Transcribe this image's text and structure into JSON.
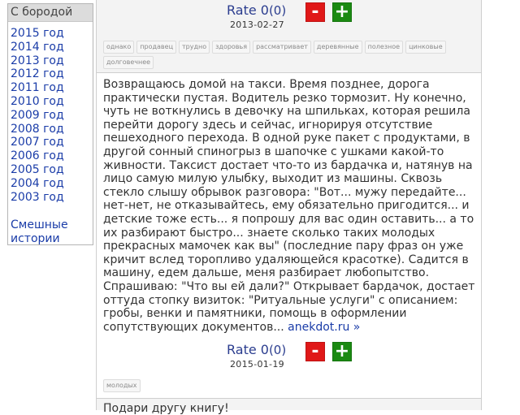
{
  "sidebar": {
    "header": "С бородой",
    "years": [
      "2015 год",
      "2014 год",
      "2013 год",
      "2012 год",
      "2011 год",
      "2010 год",
      "2009 год",
      "2008 год",
      "2007 год",
      "2006 год",
      "2005 год",
      "2004 год",
      "2003 год"
    ],
    "extra_line1": "Смешные",
    "extra_line2": "истории"
  },
  "post1": {
    "rate_label": "Rate 0",
    "rate_count": "(0)",
    "minus": "-",
    "plus": "+",
    "date": "2013-02-27",
    "tags": [
      "однако",
      "продавец",
      "трудно",
      "здоровья",
      "рассматривает",
      "деревянные",
      "полезное",
      "цинковые",
      "долговечнее"
    ]
  },
  "post2": {
    "text": "Возвращаюсь домой на такси. Время позднее, дорога практически пустая. Водитель резко тормозит. Ну конечно, чуть не воткнулись в девочку на шпильках, которая решила перейти дорогу здесь и сейчас, игнорируя отсутствие пешеходного перехода. В одной руке пакет с продуктами, в другой сонный спиногрыз в шапочке с ушками какой-то живности. Таксист достает что-то из бардачка и, натянув на лицо самую милую улыбку, выходит из машины. Сквозь стекло слышу обрывок разговора: \"Вот... мужу передайте... нет-нет, не отказывайтесь, ему обязательно пригодится... и детские тоже есть... я попрошу для вас один оставить... а то их разбирают быстро... знаете сколько таких молодых прекрасных мамочек как вы\" (последние пару фраз он уже кричит вслед торопливо удаляющейся красотке). Садится в машину, едем дальше, меня разбирает любопытство. Спрашиваю: \"Что вы ей дали?\" Открывает бардачок, достает оттуда стопку визиток: \"Ритуальные услуги\" с описанием: гробы, венки и памятники, помощь в оформлении сопутствующих документов...",
    "source_link": "anekdot.ru »",
    "rate_label": "Rate 0",
    "rate_count": "(0)",
    "minus": "-",
    "plus": "+",
    "date": "2015-01-19",
    "tags": [
      "молодых"
    ]
  },
  "post3": {
    "text": "Подари другу книгу!"
  }
}
